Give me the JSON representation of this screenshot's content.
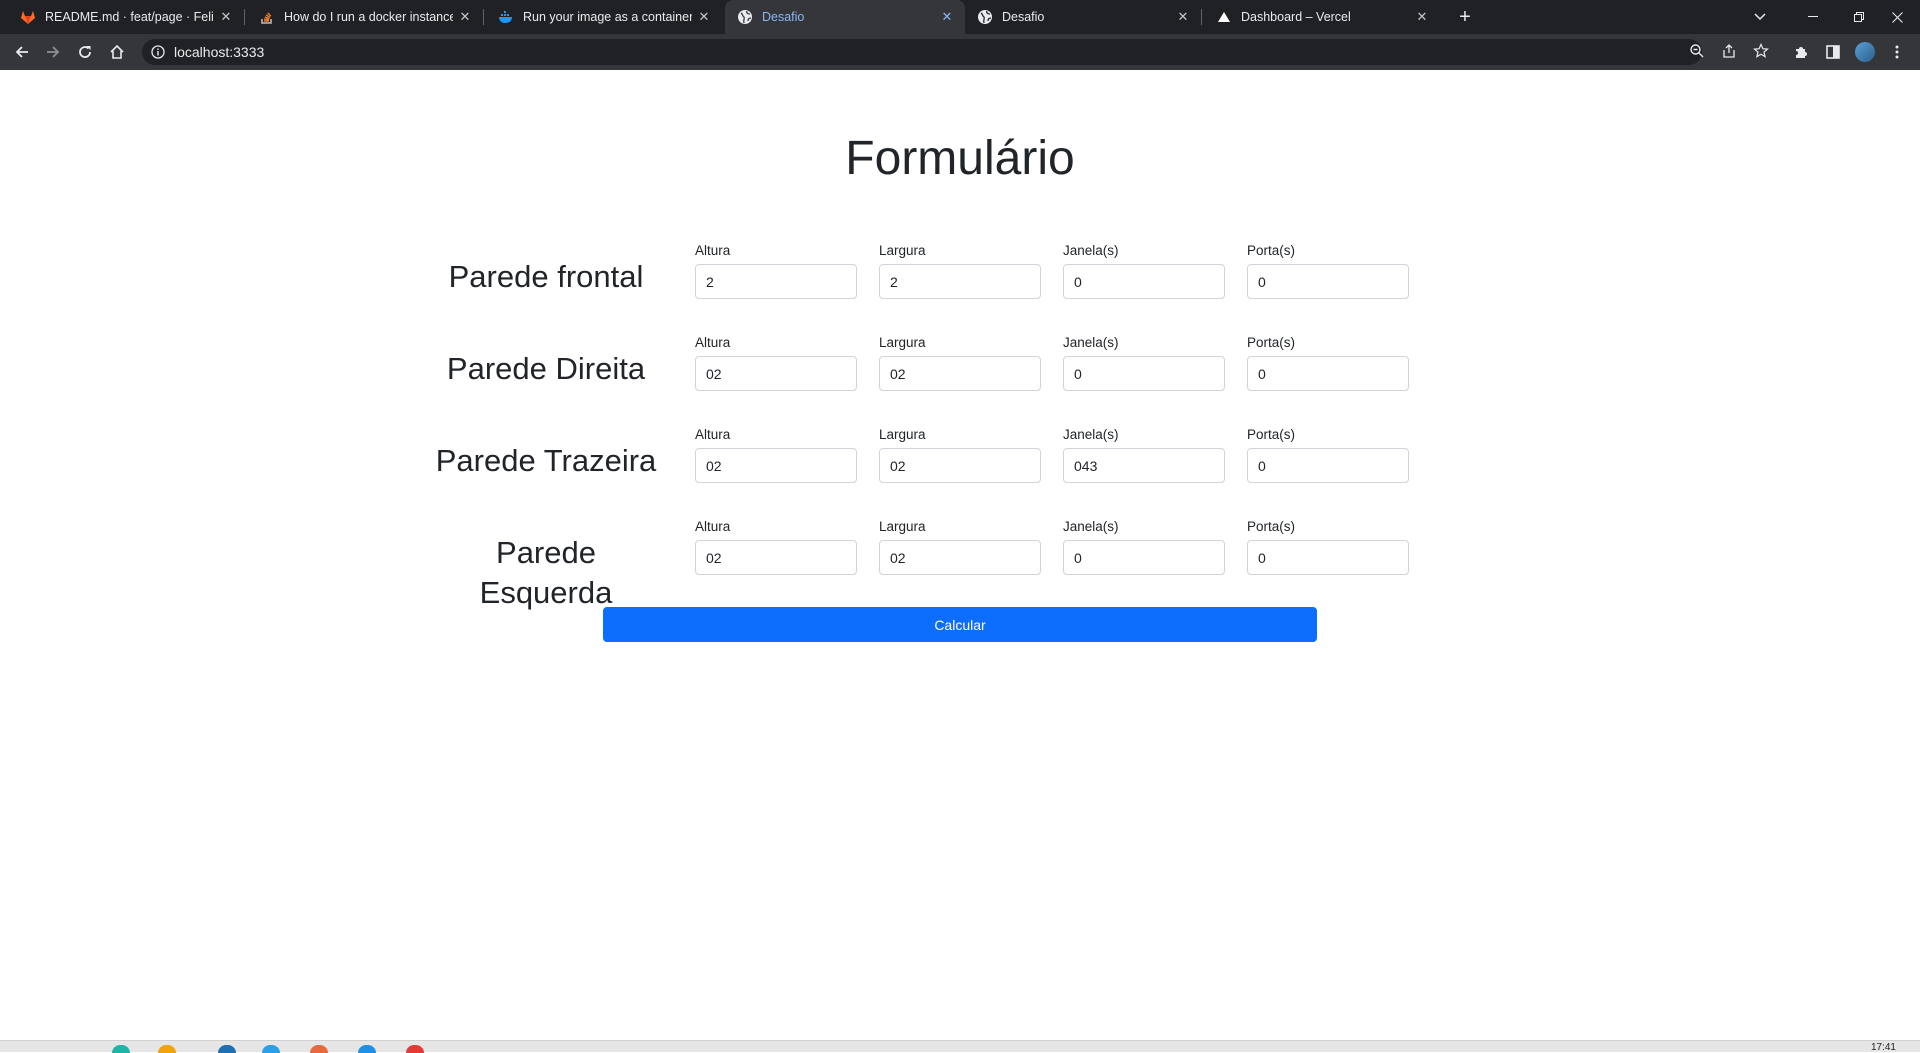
{
  "browser": {
    "tabs": [
      {
        "title": "README.md · feat/page · Felipe",
        "icon": "gitlab-icon",
        "active": false
      },
      {
        "title": "How do I run a docker instance f",
        "icon": "stackoverflow-icon",
        "active": false
      },
      {
        "title": "Run your image as a container | D",
        "icon": "docker-icon",
        "active": false
      },
      {
        "title": "Desafio",
        "icon": "globe-icon",
        "active": true
      },
      {
        "title": "Desafio",
        "icon": "globe-icon",
        "active": false
      },
      {
        "title": "Dashboard – Vercel",
        "icon": "vercel-icon",
        "active": false
      }
    ],
    "url": "localhost:3333"
  },
  "page": {
    "title": "Formulário",
    "walls": [
      {
        "label": "Parede frontal",
        "fields": [
          {
            "label": "Altura",
            "value": "2"
          },
          {
            "label": "Largura",
            "value": "2"
          },
          {
            "label": "Janela(s)",
            "value": "0"
          },
          {
            "label": "Porta(s)",
            "value": "0"
          }
        ]
      },
      {
        "label": "Parede Direita",
        "fields": [
          {
            "label": "Altura",
            "value": "02"
          },
          {
            "label": "Largura",
            "value": "02"
          },
          {
            "label": "Janela(s)",
            "value": "0"
          },
          {
            "label": "Porta(s)",
            "value": "0"
          }
        ]
      },
      {
        "label": "Parede Trazeira",
        "fields": [
          {
            "label": "Altura",
            "value": "02"
          },
          {
            "label": "Largura",
            "value": "02"
          },
          {
            "label": "Janela(s)",
            "value": "043"
          },
          {
            "label": "Porta(s)",
            "value": "0"
          }
        ]
      },
      {
        "label": "Parede Esquerda",
        "fields": [
          {
            "label": "Altura",
            "value": "02"
          },
          {
            "label": "Largura",
            "value": "02"
          },
          {
            "label": "Janela(s)",
            "value": "0"
          },
          {
            "label": "Porta(s)",
            "value": "0"
          }
        ]
      }
    ],
    "submit_label": "Calcular"
  },
  "taskbar": {
    "clock": "17:41"
  },
  "colors": {
    "primary": "#0d6efd",
    "chrome_dark": "#202124",
    "chrome_toolbar": "#35363a",
    "active_tab_text": "#8ab4f8"
  }
}
